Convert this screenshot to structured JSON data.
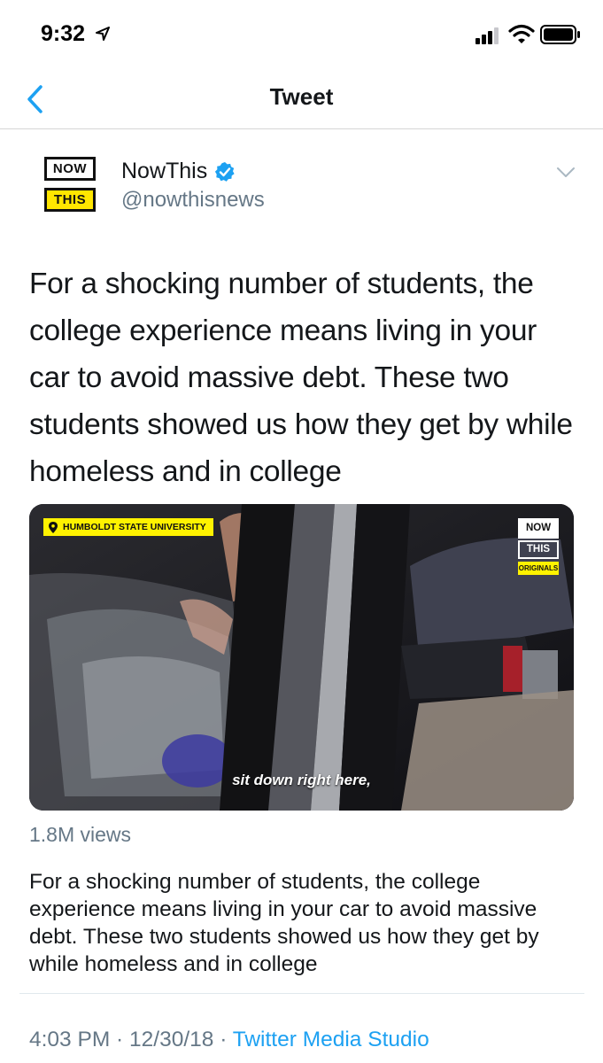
{
  "status_bar": {
    "time": "9:32"
  },
  "nav": {
    "title": "Tweet"
  },
  "author": {
    "logo_top": "NOW",
    "logo_bottom": "THIS",
    "display_name": "NowThis",
    "handle": "@nowthisnews"
  },
  "tweet": {
    "text": "For a shocking number of students, the college experience means living in your car to avoid massive debt. These two students showed us how they get by while homeless and in college"
  },
  "media": {
    "location_tag": "HUMBOLDT STATE UNIVERSITY",
    "watermark_now": "NOW",
    "watermark_this": "THIS",
    "watermark_originals": "ORIGINALS",
    "subtitle": "sit down right here,",
    "views": "1.8M views",
    "description": "For a shocking number of students, the college experience means living in your car to avoid massive debt. These two students showed us how they get by while homeless and in college"
  },
  "meta": {
    "time": "4:03 PM",
    "separator": " · ",
    "date": "12/30/18",
    "source": "Twitter Media Studio"
  },
  "colors": {
    "accent": "#1da1f2",
    "secondary_text": "#657786",
    "brand_yellow": "#ffe600"
  },
  "icons": {
    "back": "chevron-left-icon",
    "verified": "verified-badge-icon",
    "more": "chevron-down-icon",
    "location": "map-pin-icon"
  }
}
